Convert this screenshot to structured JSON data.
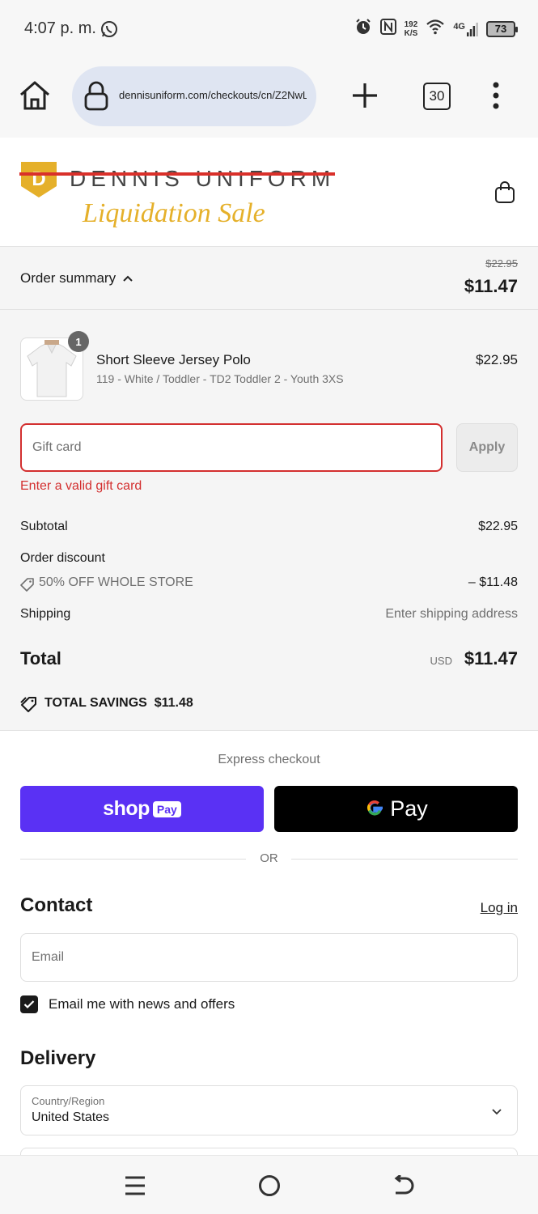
{
  "status_bar": {
    "time": "4:07 p. m.",
    "speed_value": "192",
    "speed_unit": "K/S",
    "network": "4G",
    "battery": "73"
  },
  "browser": {
    "url": "dennisuniform.com/checkouts/cn/Z2NwL",
    "tab_count": "30"
  },
  "store": {
    "logo_brand": "DENNIS UNIFORM",
    "logo_letter": "D",
    "logo_tagline": "Liquidation Sale"
  },
  "summary": {
    "toggle_label": "Order summary",
    "original_total": "$22.95",
    "total": "$11.47",
    "item": {
      "quantity": "1",
      "name": "Short Sleeve Jersey Polo",
      "variant": "119 - White / Toddler - TD2 Toddler 2 - Youth 3XS",
      "price": "$22.95"
    },
    "gift_card": {
      "placeholder": "Gift card",
      "apply_label": "Apply",
      "error": "Enter a valid gift card"
    },
    "subtotal_label": "Subtotal",
    "subtotal_value": "$22.95",
    "discount_label": "Order discount",
    "discount_code": "50% OFF WHOLE STORE",
    "discount_value": "– $11.48",
    "shipping_label": "Shipping",
    "shipping_value": "Enter shipping address",
    "total_label": "Total",
    "currency": "USD",
    "total_value": "$11.47",
    "savings_label": "TOTAL SAVINGS",
    "savings_value": "$11.48"
  },
  "express": {
    "label": "Express checkout",
    "shop_pay_word": "shop",
    "shop_pay_pill": "Pay",
    "gpay_word": "Pay",
    "or_label": "OR"
  },
  "contact": {
    "heading": "Contact",
    "login_label": "Log in",
    "email_placeholder": "Email",
    "newsletter_label": "Email me with news and offers",
    "newsletter_checked": true
  },
  "delivery": {
    "heading": "Delivery",
    "country_label": "Country/Region",
    "country_value": "United States"
  },
  "colors": {
    "error": "#d32f2f",
    "shop_pay": "#5a31f4",
    "logo_gold": "#e5b02a",
    "logo_strike": "#d9302a"
  }
}
